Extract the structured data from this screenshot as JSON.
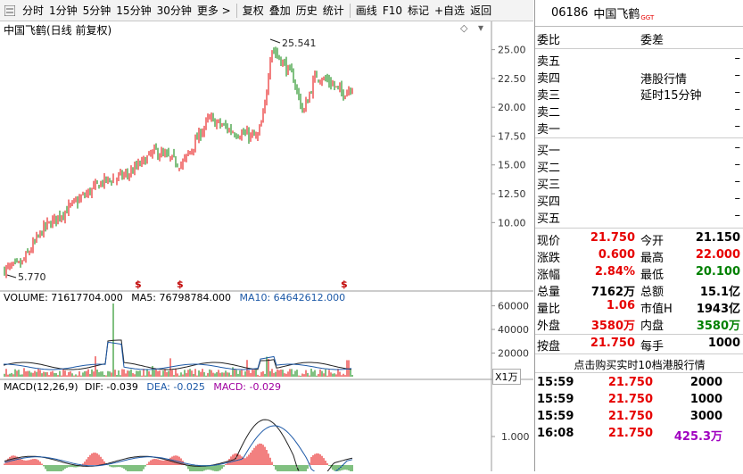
{
  "toolbar": {
    "items": [
      "分时",
      "1分钟",
      "5分钟",
      "15分钟",
      "30分钟",
      "更多 >",
      "复权",
      "叠加",
      "历史",
      "统计",
      "画线",
      "F10",
      "标记",
      "+自选",
      "返回"
    ]
  },
  "chart": {
    "title": "中国飞鹤(日线 前复权)",
    "high_label": "25.541",
    "low_label": "5.770",
    "price_axis": [
      "25.00",
      "22.50",
      "20.00",
      "17.50",
      "15.00",
      "12.50",
      "10.00"
    ],
    "dividend_marker": "$",
    "volume_legend": {
      "volume": "VOLUME: 71617704.000",
      "ma5": "MA5: 76798784.000",
      "ma10": "MA10: 64642612.000"
    },
    "volume_axis": [
      "60000",
      "40000",
      "20000"
    ],
    "volume_unit": "X1万",
    "macd_legend": {
      "name": "MACD(12,26,9)",
      "dif": "DIF: -0.039",
      "dea": "DEA: -0.025",
      "macd": "MACD: -0.029"
    },
    "macd_axis": [
      "1.000"
    ]
  },
  "quote": {
    "code": "06186",
    "name": "中国飞鹤",
    "tag": "GGT",
    "weibi_label": "委比",
    "weicha_label": "委差",
    "sell": [
      {
        "label": "卖五",
        "v": "–"
      },
      {
        "label": "卖四",
        "v": "–"
      },
      {
        "label": "卖三",
        "v": "–"
      },
      {
        "label": "卖二",
        "v": "–"
      },
      {
        "label": "卖一",
        "v": "–"
      }
    ],
    "buy": [
      {
        "label": "买一",
        "v": "–"
      },
      {
        "label": "买二",
        "v": "–"
      },
      {
        "label": "买三",
        "v": "–"
      },
      {
        "label": "买四",
        "v": "–"
      },
      {
        "label": "买五",
        "v": "–"
      }
    ],
    "notice1": "港股行情",
    "notice2": "延时15分钟",
    "stats": [
      {
        "l1": "现价",
        "v1": "21.750",
        "c1": "red",
        "l2": "今开",
        "v2": "21.150",
        "c2": ""
      },
      {
        "l1": "涨跌",
        "v1": "0.600",
        "c1": "red",
        "l2": "最高",
        "v2": "22.000",
        "c2": "red"
      },
      {
        "l1": "涨幅",
        "v1": "2.84%",
        "c1": "red",
        "l2": "最低",
        "v2": "20.100",
        "c2": "green"
      },
      {
        "l1": "总量",
        "v1": "7162万",
        "c1": "",
        "l2": "总额",
        "v2": "15.1亿",
        "c2": ""
      },
      {
        "l1": "量比",
        "v1": "1.06",
        "c1": "red",
        "l2": "市值H",
        "v2": "1943亿",
        "c2": ""
      },
      {
        "l1": "外盘",
        "v1": "3580万",
        "c1": "red",
        "l2": "内盘",
        "v2": "3580万",
        "c2": "green"
      }
    ],
    "anpan": {
      "l1": "按盘",
      "v1": "21.750",
      "l2": "每手",
      "v2": "1000"
    },
    "banner": "点击购买实时10档港股行情",
    "ticks": [
      {
        "t": "15:59",
        "p": "21.750",
        "v": "2000",
        "vc": ""
      },
      {
        "t": "15:59",
        "p": "21.750",
        "v": "1000",
        "vc": ""
      },
      {
        "t": "15:59",
        "p": "21.750",
        "v": "3000",
        "vc": ""
      },
      {
        "t": "16:08",
        "p": "21.750",
        "v": "425.3万",
        "vc": "purple"
      }
    ]
  }
}
